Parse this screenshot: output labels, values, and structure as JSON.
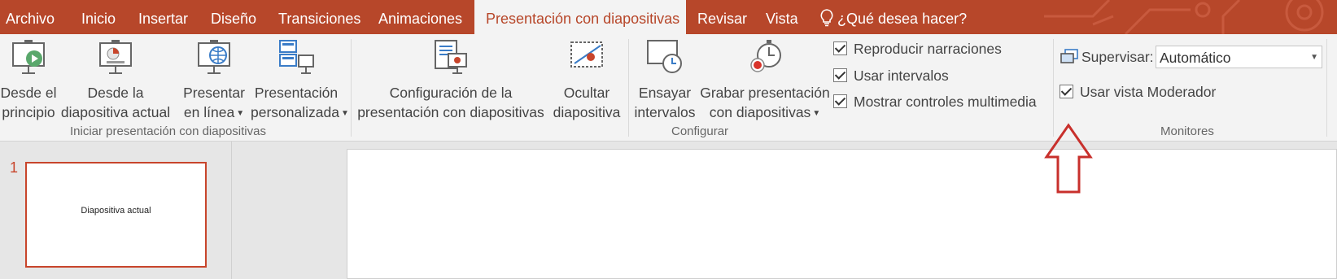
{
  "tabs": [
    {
      "label": "Archivo"
    },
    {
      "label": "Inicio"
    },
    {
      "label": "Insertar"
    },
    {
      "label": "Diseño"
    },
    {
      "label": "Transiciones"
    },
    {
      "label": "Animaciones"
    },
    {
      "label": "Presentación con diapositivas",
      "active": true
    },
    {
      "label": "Revisar"
    },
    {
      "label": "Vista"
    }
  ],
  "tell_me": {
    "text": "¿Qué desea hacer?"
  },
  "groups": {
    "start": {
      "label": "Iniciar presentación con diapositivas",
      "buttons": [
        {
          "line1": "Desde el",
          "line2": "principio",
          "icon": "play-from-start-icon"
        },
        {
          "line1": "Desde la",
          "line2": "diapositiva actual",
          "icon": "play-from-current-icon"
        },
        {
          "line1": "Presentar",
          "line2": "en línea",
          "icon": "present-online-icon",
          "dropdown": true
        },
        {
          "line1": "Presentación",
          "line2": "personalizada",
          "icon": "custom-show-icon",
          "dropdown": true
        }
      ]
    },
    "setup": {
      "label": "Configurar",
      "buttons": [
        {
          "line1": "Configuración de la",
          "line2": "presentación con diapositivas",
          "icon": "setup-slideshow-icon"
        },
        {
          "line1": "Ocultar",
          "line2": "diapositiva",
          "icon": "hide-slide-icon"
        },
        {
          "line1": "Ensayar",
          "line2": "intervalos",
          "icon": "rehearse-timings-icon"
        },
        {
          "line1": "Grabar presentación",
          "line2": "con diapositivas",
          "icon": "record-slideshow-icon",
          "dropdown": true
        }
      ],
      "checkboxes": [
        {
          "label": "Reproducir narraciones",
          "checked": true
        },
        {
          "label": "Usar intervalos",
          "checked": true
        },
        {
          "label": "Mostrar controles multimedia",
          "checked": true
        }
      ]
    },
    "monitors": {
      "label": "Monitores",
      "monitor_label": "Supervisar:",
      "monitor_value": "Automático",
      "presenter_view": {
        "label": "Usar vista Moderador",
        "checked": true
      }
    }
  },
  "thumbnails": [
    {
      "number": "1",
      "text": "Diapositiva actual"
    }
  ],
  "colors": {
    "accent": "#b7472a",
    "ribbon": "#f3f3f3",
    "arrow": "#c8302c"
  }
}
